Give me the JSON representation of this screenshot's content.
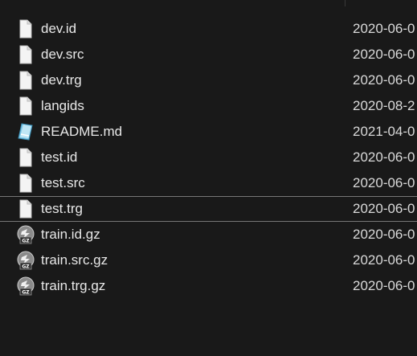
{
  "files": [
    {
      "name": "dev.id",
      "date": "2020-06-0",
      "icon": "blank-file-icon"
    },
    {
      "name": "dev.src",
      "date": "2020-06-0",
      "icon": "blank-file-icon"
    },
    {
      "name": "dev.trg",
      "date": "2020-06-0",
      "icon": "blank-file-icon"
    },
    {
      "name": "langids",
      "date": "2020-08-2",
      "icon": "blank-file-icon"
    },
    {
      "name": "README.md",
      "date": "2021-04-0",
      "icon": "markdown-file-icon"
    },
    {
      "name": "test.id",
      "date": "2020-06-0",
      "icon": "blank-file-icon"
    },
    {
      "name": "test.src",
      "date": "2020-06-0",
      "icon": "blank-file-icon"
    },
    {
      "name": "test.trg",
      "date": "2020-06-0",
      "icon": "blank-file-icon",
      "selected": true
    },
    {
      "name": "train.id.gz",
      "date": "2020-06-0",
      "icon": "gz-archive-icon"
    },
    {
      "name": "train.src.gz",
      "date": "2020-06-0",
      "icon": "gz-archive-icon"
    },
    {
      "name": "train.trg.gz",
      "date": "2020-06-0",
      "icon": "gz-archive-icon"
    }
  ],
  "gz_badge": "GZ",
  "colors": {
    "background": "#191919",
    "text": "#e8e8e8",
    "selection_border": "#777777"
  }
}
